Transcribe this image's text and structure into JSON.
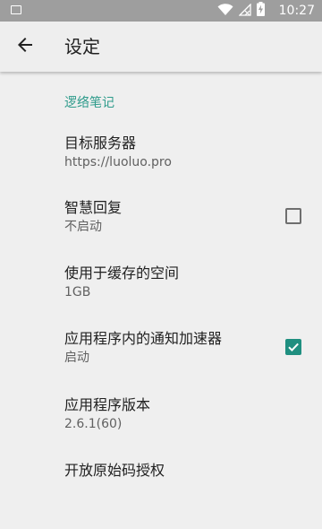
{
  "status_bar": {
    "time": "10:27",
    "icons": [
      "image-icon",
      "wifi-icon",
      "no-signal-icon",
      "battery-charging-icon"
    ]
  },
  "app_bar": {
    "title": "设定",
    "back_icon": "arrow-back-icon"
  },
  "settings": {
    "category": "逻络笔记",
    "items": [
      {
        "title": "目标服务器",
        "summary": "https://luoluo.pro"
      },
      {
        "title": "智慧回复",
        "summary": "不启动",
        "checkbox": false
      },
      {
        "title": "使用于缓存的空间",
        "summary": "1GB"
      },
      {
        "title": "应用程序内的通知加速器",
        "summary": "启动",
        "checkbox": true
      },
      {
        "title": "应用程序版本",
        "summary": "2.6.1(60)"
      },
      {
        "title": "开放原始码授权"
      }
    ]
  },
  "colors": {
    "accent": "#2e9b8b",
    "checkbox_on": "#1f8f80",
    "status_bar": "#9e9e9e",
    "background": "#efefef"
  }
}
